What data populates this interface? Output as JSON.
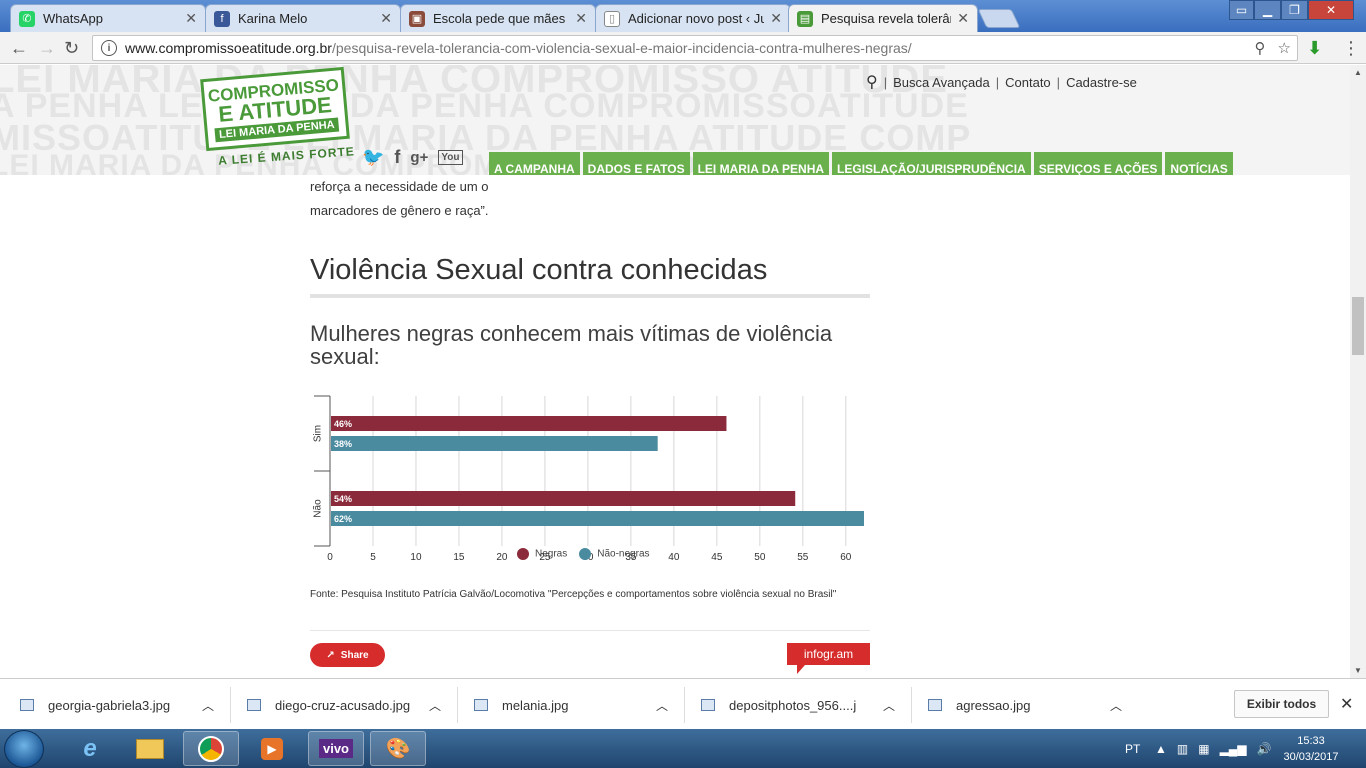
{
  "browser": {
    "tabs": [
      {
        "title": "WhatsApp",
        "favicon": "whatsapp-icon",
        "color": "#25d366"
      },
      {
        "title": "Karina Melo",
        "favicon": "facebook-icon",
        "color": "#3b5998"
      },
      {
        "title": "Escola pede que mães b",
        "favicon": "news-icon",
        "color": "#8a4b3a"
      },
      {
        "title": "Adicionar novo post ‹ Ju",
        "favicon": "document-icon",
        "color": "#888888"
      },
      {
        "title": "Pesquisa revela tolerânci",
        "favicon": "site-icon",
        "color": "#4a9a3a"
      }
    ],
    "url_host": "www.compromissoeatitude.org.br",
    "url_path": "/pesquisa-revela-tolerancia-com-violencia-sexual-e-maior-incidencia-contra-mulheres-negras/"
  },
  "site": {
    "logo_line1": "COMPROMISSO",
    "logo_line2": "E ATITUDE",
    "logo_line3": "LEI MARIA DA PENHA",
    "tagline": "A LEI É MAIS FORTE",
    "watermark_lines": [
      "LEI MARIA DA PENHA COMPROMISSO ATITUDE",
      "A PENHA LEI MARIA DA PENHA COMPROMISSOATITUDE",
      "MISSOATITUDE LEI MARIA DA PENHA ATITUDE COMP",
      "LEI MARIA DA PENHA COMPROMISSO ATITUDE"
    ],
    "top_links": [
      "Busca Avançada",
      "Contato",
      "Cadastre-se"
    ],
    "social": [
      "twitter-icon",
      "facebook-icon",
      "googleplus-icon",
      "youtube-icon"
    ],
    "nav": [
      "A CAMPANHA",
      "DADOS E FATOS",
      "LEI MARIA DA PENHA",
      "LEGISLAÇÃO/JURISPRUDÊNCIA",
      "SERVIÇOS E AÇÕES",
      "NOTÍCIAS"
    ],
    "accent": "#6ab04c"
  },
  "article": {
    "intro_line1": "reforça a necessidade de um o",
    "intro_line2": "marcadores de gênero e raça”.",
    "section_heading": "Violência Sexual contra conhecidas",
    "chart_title": "Mulheres negras conhecem mais vítimas de violência sexual:",
    "source": "Fonte: Pesquisa Instituto Patrícia Galvão/Locomotiva \"Percepções e comportamentos sobre violência sexual no Brasil\"",
    "share_label": "Share",
    "infogram_label": "infogr.am"
  },
  "chart_data": {
    "type": "bar",
    "orientation": "horizontal",
    "title": "Mulheres negras conhecem mais vítimas de violência sexual:",
    "categories": [
      "Sim",
      "Não"
    ],
    "series": [
      {
        "name": "Negras",
        "values": [
          46,
          54
        ],
        "color": "#8b2a3a"
      },
      {
        "name": "Não-negras",
        "values": [
          38,
          62
        ],
        "color": "#4a8ba0"
      }
    ],
    "value_labels": [
      [
        "46%",
        "54%"
      ],
      [
        "38%",
        "62%"
      ]
    ],
    "xticks": [
      0,
      5,
      10,
      15,
      20,
      25,
      30,
      35,
      40,
      45,
      50,
      55,
      60
    ],
    "xlim": [
      0,
      62
    ],
    "grid": true,
    "legend_position": "bottom"
  },
  "downloads": {
    "items": [
      "georgia-gabriela3.jpg",
      "diego-cruz-acusado.jpg",
      "melania.jpg",
      "depositphotos_956....j",
      "agressao.jpg"
    ],
    "show_all": "Exibir todos"
  },
  "taskbar": {
    "apps": [
      "ie-icon",
      "explorer-icon",
      "chrome-icon",
      "media-icon",
      "vivo-icon",
      "paint-icon"
    ],
    "vivo_label": "vivo",
    "lang": "PT",
    "time": "15:33",
    "date": "30/03/2017"
  }
}
